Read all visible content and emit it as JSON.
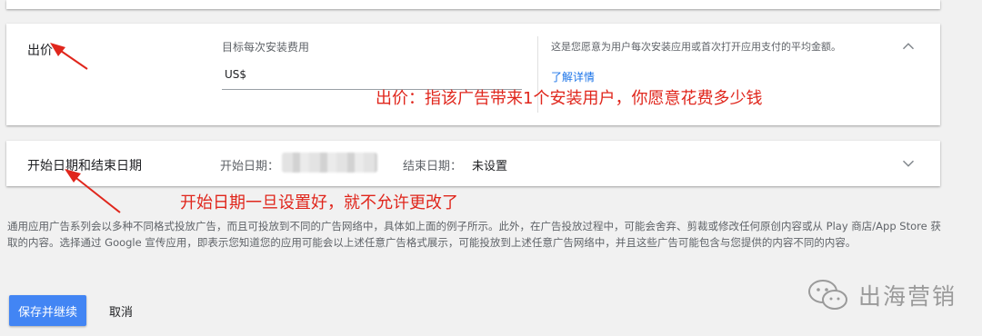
{
  "bid_section": {
    "title": "出价",
    "field_label": "目标每次安装费用",
    "currency": "US$",
    "help_text": "这是您愿意为用户每次安装应用或首次打开应用支付的平均金额。",
    "learn_more": "了解详情",
    "annotation": "出价：指该广告带来1个安装用户，你愿意花费多少钱"
  },
  "dates_section": {
    "title": "开始日期和结束日期",
    "start_label": "开始日期：",
    "end_label": "结束日期：",
    "end_value": "未设置",
    "annotation": "开始日期一旦设置好，就不允许更改了"
  },
  "disclaimer": "通用应用广告系列会以多种不同格式投放广告，而且可投放到不同的广告网络中，具体如上面的例子所示。此外，在广告投放过程中，可能会舍弃、剪裁或修改任何原创内容或从 Play 商店/App Store 获取的内容。选择通过 Google 宣传应用，即表示您知道您的应用可能会以上述任意广告格式展示，可能投放到上述任意广告网络中，并且这些广告可能包含与您提供的内容不同的内容。",
  "buttons": {
    "save": "保存并继续",
    "cancel": "取消"
  },
  "watermark": {
    "text": "出海营销",
    "icon": "wechat-icon"
  },
  "colors": {
    "primary": "#4285f4",
    "link": "#1a73e8",
    "annotation": "#e0261c"
  }
}
